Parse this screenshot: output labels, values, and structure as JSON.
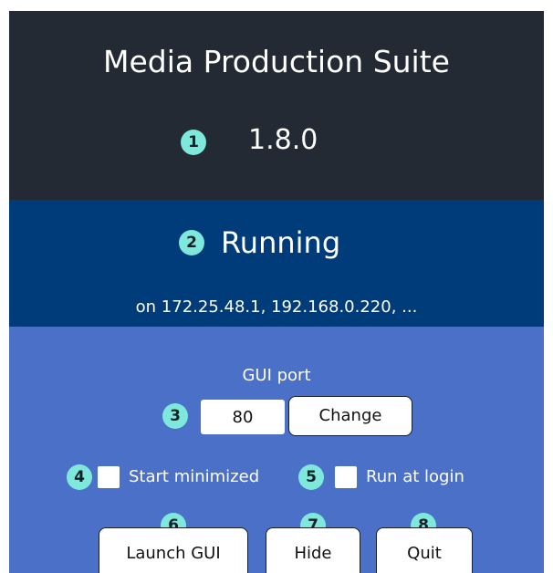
{
  "app": {
    "title": "Media Production Suite",
    "version": "1.8.0"
  },
  "status": {
    "state": "Running",
    "addresses": "on 172.25.48.1, 192.168.0.220, ..."
  },
  "controls": {
    "port_label": "GUI port",
    "port_value": "80",
    "change_label": "Change",
    "start_minimized_label": "Start minimized",
    "start_minimized_checked": false,
    "run_at_login_label": "Run at login",
    "run_at_login_checked": false,
    "launch_label": "Launch GUI",
    "hide_label": "Hide",
    "quit_label": "Quit"
  },
  "badges": [
    "1",
    "2",
    "3",
    "4",
    "5",
    "6",
    "7",
    "8"
  ],
  "colors": {
    "header_bg": "#242a33",
    "status_bg": "#003b7a",
    "controls_bg": "#4a70c8",
    "badge": "#7ee8dc"
  }
}
